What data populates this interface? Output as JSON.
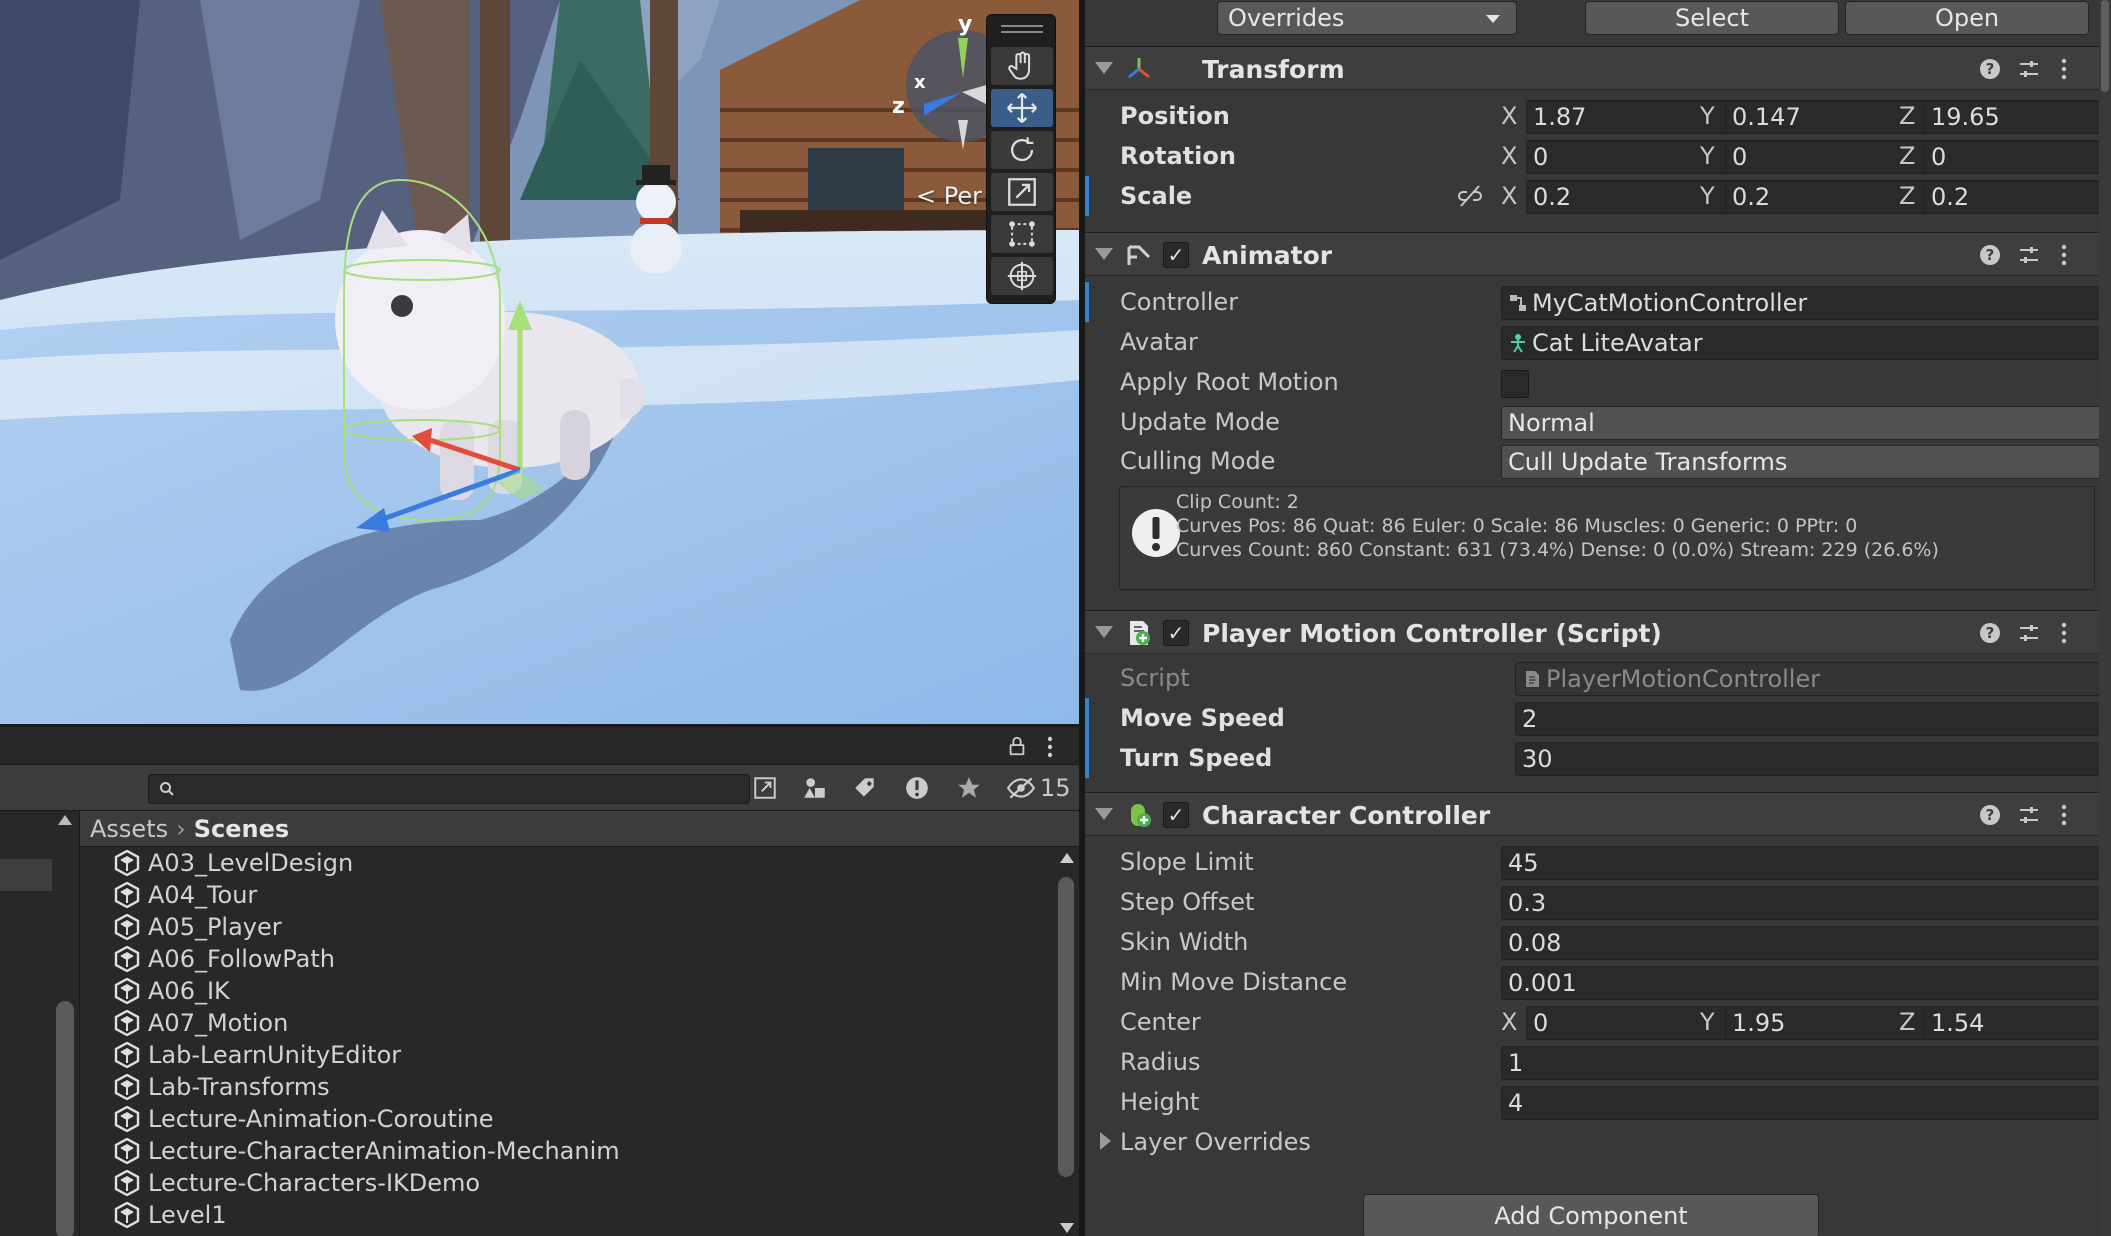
{
  "scene_view": {
    "orientation_gizmo": {
      "y_axis": "y",
      "z_axis": "z",
      "x_axis": "x"
    },
    "perspective_label": "< Per",
    "tools": [
      {
        "name": "hand-tool",
        "icon": "hand-icon"
      },
      {
        "name": "move-tool",
        "icon": "move-arrows-icon",
        "active": true
      },
      {
        "name": "rotate-tool",
        "icon": "rotate-icon"
      },
      {
        "name": "scale-tool",
        "icon": "scale-icon"
      },
      {
        "name": "rect-tool",
        "icon": "rect-transform-icon"
      },
      {
        "name": "transform-tool",
        "icon": "transform-icon"
      }
    ]
  },
  "project": {
    "search": {
      "placeholder": ""
    },
    "hidden_packages_count": "15",
    "breadcrumb": {
      "root": "Assets",
      "current": "Scenes"
    },
    "scenes": [
      "A03_LevelDesign",
      "A04_Tour",
      "A05_Player",
      "A06_FollowPath",
      "A06_IK",
      "A07_Motion",
      "Lab-LearnUnityEditor",
      "Lab-Transforms",
      "Lecture-Animation-Coroutine",
      "Lecture-CharacterAnimation-Mechanim",
      "Lecture-Characters-IKDemo",
      "Level1"
    ]
  },
  "inspector": {
    "prefab": {
      "overrides": "Overrides",
      "select": "Select",
      "open": "Open"
    },
    "transform": {
      "title": "Transform",
      "position": {
        "label": "Position",
        "x": "1.87",
        "y": "0.147",
        "z": "19.65"
      },
      "rotation": {
        "label": "Rotation",
        "x": "0",
        "y": "0",
        "z": "0"
      },
      "scale": {
        "label": "Scale",
        "x": "0.2",
        "y": "0.2",
        "z": "0.2"
      }
    },
    "animator": {
      "title": "Animator",
      "controller": {
        "label": "Controller",
        "value": "MyCatMotionController"
      },
      "avatar": {
        "label": "Avatar",
        "value": "Cat LiteAvatar"
      },
      "apply_root_motion": {
        "label": "Apply Root Motion",
        "checked": false
      },
      "update_mode": {
        "label": "Update Mode",
        "value": "Normal"
      },
      "culling_mode": {
        "label": "Culling Mode",
        "value": "Cull Update Transforms"
      },
      "info": {
        "line1": "Clip Count: 2",
        "line2": "Curves Pos: 86 Quat: 86 Euler: 0 Scale: 86 Muscles: 0 Generic: 0 PPtr: 0",
        "line3": "Curves Count: 860 Constant: 631 (73.4%) Dense: 0 (0.0%) Stream: 229 (26.6%)"
      }
    },
    "player_motion": {
      "title": "Player Motion Controller (Script)",
      "script": {
        "label": "Script",
        "value": "PlayerMotionController"
      },
      "move_speed": {
        "label": "Move Speed",
        "value": "2"
      },
      "turn_speed": {
        "label": "Turn Speed",
        "value": "30"
      }
    },
    "character_controller": {
      "title": "Character Controller",
      "slope_limit": {
        "label": "Slope Limit",
        "value": "45"
      },
      "step_offset": {
        "label": "Step Offset",
        "value": "0.3"
      },
      "skin_width": {
        "label": "Skin Width",
        "value": "0.08"
      },
      "min_move_distance": {
        "label": "Min Move Distance",
        "value": "0.001"
      },
      "center": {
        "label": "Center",
        "x": "0",
        "y": "1.95",
        "z": "1.54"
      },
      "radius": {
        "label": "Radius",
        "value": "1"
      },
      "height": {
        "label": "Height",
        "value": "4"
      },
      "layer_overrides": {
        "label": "Layer Overrides"
      }
    },
    "add_component": "Add Component",
    "axis_labels": {
      "x": "X",
      "y": "Y",
      "z": "Z"
    }
  },
  "colors": {
    "accent_blue": "#2f87d2",
    "panel_bg": "#383838",
    "field_bg": "#2a2a2a"
  }
}
